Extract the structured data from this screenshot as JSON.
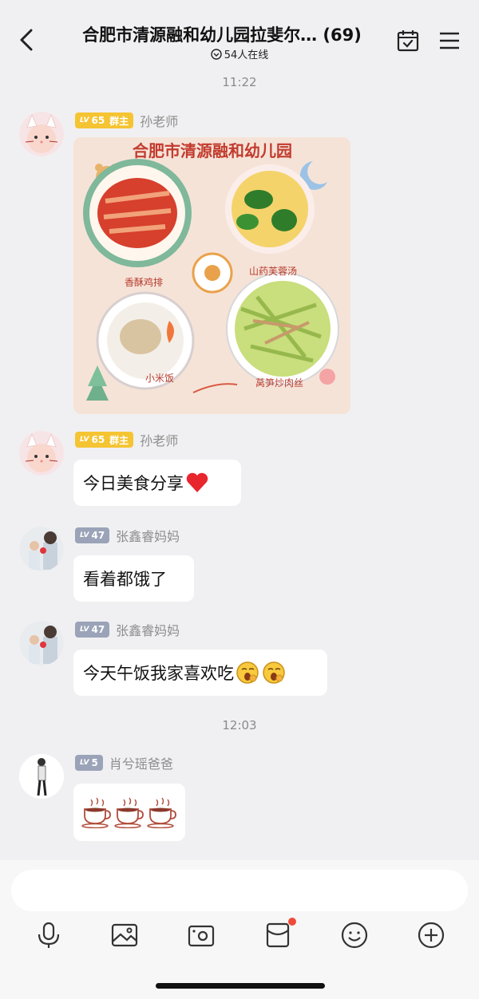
{
  "header": {
    "title": "合肥市清源融和幼儿园拉斐尔… (69)",
    "online_count": "54人在线"
  },
  "chat": {
    "timestamps": [
      "11:22",
      "12:03"
    ],
    "messages": [
      {
        "badge_level": "65",
        "badge_role": "群主",
        "sender": "孙老师",
        "type": "image",
        "image": {
          "title": "合肥市清源融和幼儿园",
          "dishes": [
            "香酥鸡排",
            "山药芙蓉汤",
            "小米饭",
            "莴笋炒肉丝"
          ]
        }
      },
      {
        "badge_level": "65",
        "badge_role": "群主",
        "sender": "孙老师",
        "type": "text",
        "text": "今日美食分享"
      },
      {
        "badge_level": "47",
        "sender": "张鑫睿妈妈",
        "type": "text",
        "text": "看着都饿了"
      },
      {
        "badge_level": "47",
        "sender": "张鑫睿妈妈",
        "type": "text",
        "text": "今天午饭我家喜欢吃"
      },
      {
        "badge_level": "5",
        "sender": "肖兮瑶爸爸",
        "type": "emoji",
        "emoji": "coffee-cup-emoji x3"
      }
    ]
  },
  "badges": {
    "lv_prefix": "LV"
  },
  "toolbar": {
    "icons": [
      "microphone-icon",
      "image-icon",
      "camera-icon",
      "red-packet-icon",
      "smile-icon",
      "plus-icon"
    ]
  },
  "colors": {
    "owner_badge": "#f5c432",
    "member_badge": "#9aa3b8",
    "notification_dot": "#f04b3a",
    "background": "#f0f0f2"
  }
}
